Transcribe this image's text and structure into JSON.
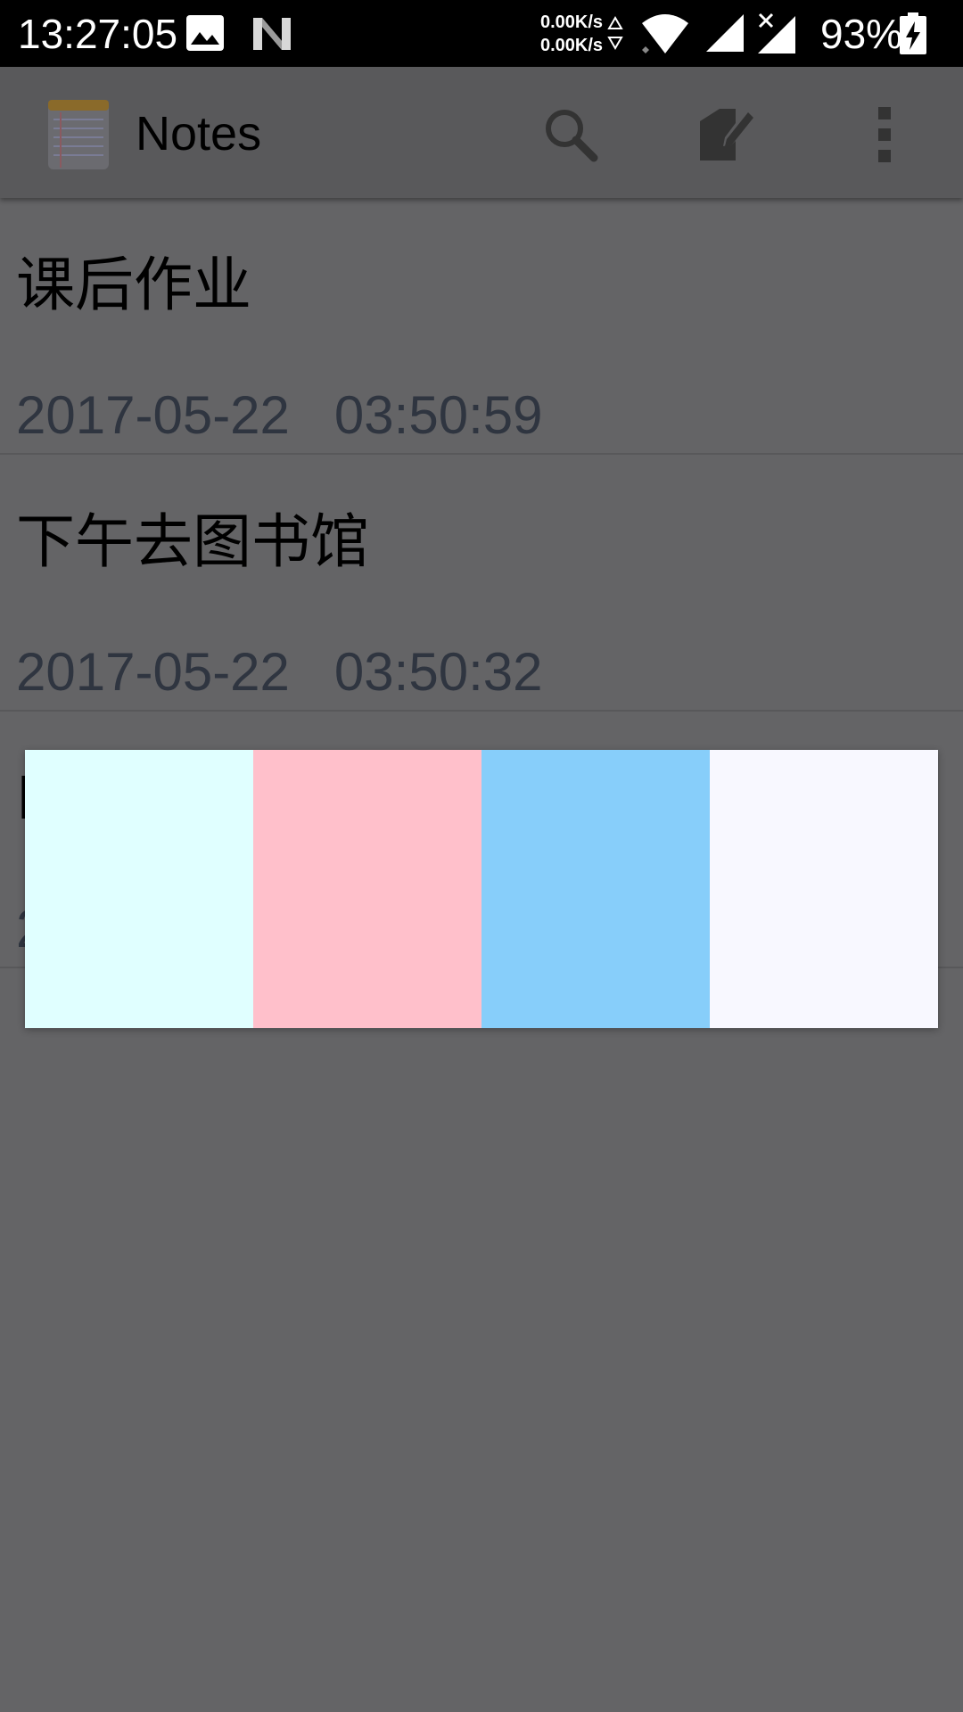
{
  "status_bar": {
    "time": "13:27:05",
    "net_up": "0.00K/s",
    "net_down": "0.00K/s",
    "battery": "93%",
    "icons": [
      "image-icon",
      "n-icon",
      "wifi-icon",
      "signal-icon",
      "signal-no-data-icon",
      "battery-charging-icon"
    ]
  },
  "action_bar": {
    "title": "Notes",
    "icons": [
      "notepad-logo-icon",
      "search-icon",
      "new-note-icon",
      "more-vert-icon"
    ]
  },
  "notes": [
    {
      "title": "课后作业",
      "date": "2017-05-22   03:50:59"
    },
    {
      "title": "下午去图书馆",
      "date": "2017-05-22   03:50:32"
    },
    {
      "title": "E",
      "date": "2"
    }
  ],
  "color_picker": {
    "colors": [
      "#E0FFFF",
      "#FFC0CB",
      "#87CEFA",
      "#F8F8FF"
    ]
  },
  "theme": {
    "dim_background": "#646466",
    "status_bar": "#000000",
    "date_text": "#2f3540"
  }
}
